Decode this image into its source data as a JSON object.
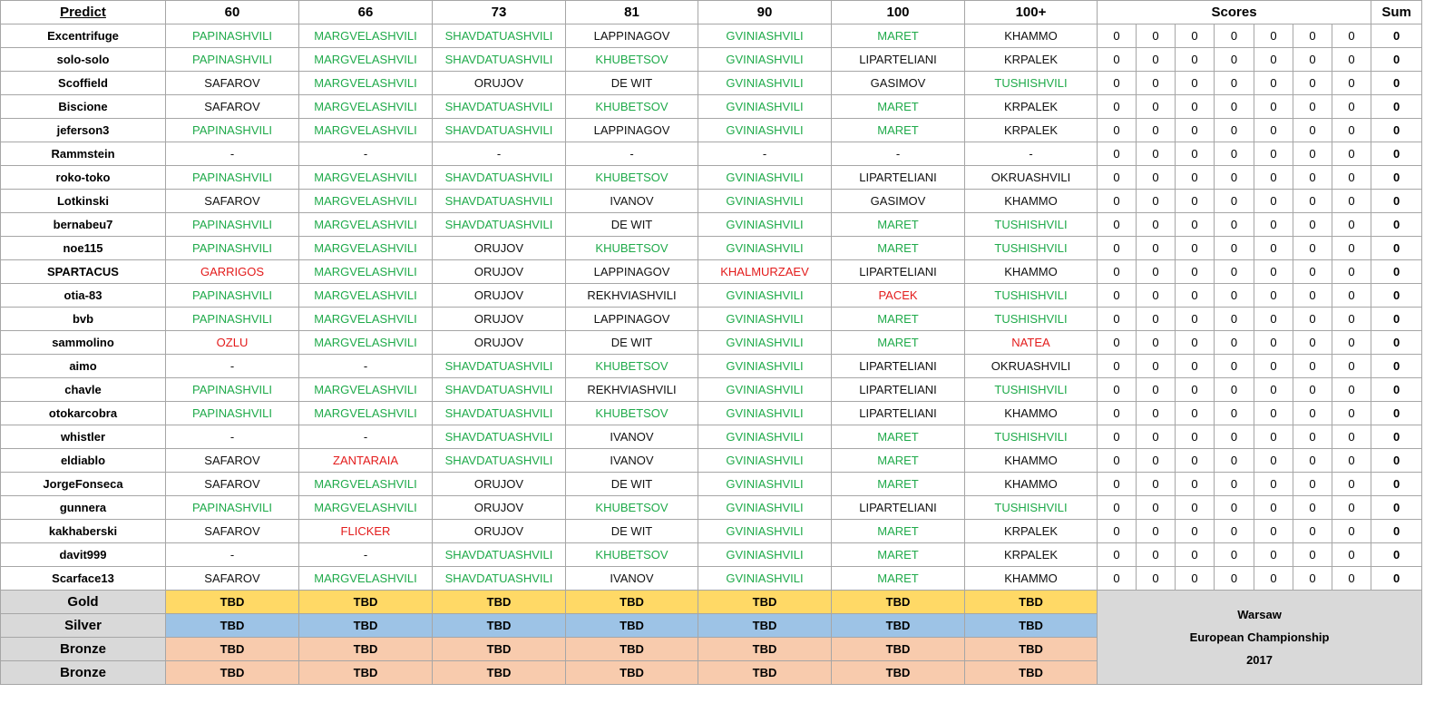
{
  "header": {
    "predict": "Predict",
    "categories": [
      "60",
      "66",
      "73",
      "81",
      "90",
      "100",
      "100+"
    ],
    "scores": "Scores",
    "sum": "Sum"
  },
  "colors": {
    "correct": "#1faa4a",
    "wrong": "#e31b1b",
    "neutral": "#111111",
    "gold": "#ffd966",
    "silver": "#9dc3e6",
    "bronze": "#f8cbad",
    "label_bg": "#d9d9d9"
  },
  "rows": [
    {
      "name": "Excentrifuge",
      "picks": [
        [
          "PAPINASHVILI",
          "g"
        ],
        [
          "MARGVELASHVILI",
          "g"
        ],
        [
          "SHAVDATUASHVILI",
          "g"
        ],
        [
          "LAPPINAGOV",
          "b"
        ],
        [
          "GVINIASHVILI",
          "g"
        ],
        [
          "MARET",
          "g"
        ],
        [
          "KHAMMO",
          "b"
        ]
      ],
      "scores": [
        "0",
        "0",
        "0",
        "0",
        "0",
        "0",
        "0"
      ],
      "sum": "0"
    },
    {
      "name": "solo-solo",
      "picks": [
        [
          "PAPINASHVILI",
          "g"
        ],
        [
          "MARGVELASHVILI",
          "g"
        ],
        [
          "SHAVDATUASHVILI",
          "g"
        ],
        [
          "KHUBETSOV",
          "g"
        ],
        [
          "GVINIASHVILI",
          "g"
        ],
        [
          "LIPARTELIANI",
          "b"
        ],
        [
          "KRPALEK",
          "b"
        ]
      ],
      "scores": [
        "0",
        "0",
        "0",
        "0",
        "0",
        "0",
        "0"
      ],
      "sum": "0"
    },
    {
      "name": "Scoffield",
      "picks": [
        [
          "SAFAROV",
          "b"
        ],
        [
          "MARGVELASHVILI",
          "g"
        ],
        [
          "ORUJOV",
          "b"
        ],
        [
          "DE WIT",
          "b"
        ],
        [
          "GVINIASHVILI",
          "g"
        ],
        [
          "GASIMOV",
          "b"
        ],
        [
          "TUSHISHVILI",
          "g"
        ]
      ],
      "scores": [
        "0",
        "0",
        "0",
        "0",
        "0",
        "0",
        "0"
      ],
      "sum": "0"
    },
    {
      "name": "Biscione",
      "picks": [
        [
          "SAFAROV",
          "b"
        ],
        [
          "MARGVELASHVILI",
          "g"
        ],
        [
          "SHAVDATUASHVILI",
          "g"
        ],
        [
          "KHUBETSOV",
          "g"
        ],
        [
          "GVINIASHVILI",
          "g"
        ],
        [
          "MARET",
          "g"
        ],
        [
          "KRPALEK",
          "b"
        ]
      ],
      "scores": [
        "0",
        "0",
        "0",
        "0",
        "0",
        "0",
        "0"
      ],
      "sum": "0"
    },
    {
      "name": "jeferson3",
      "picks": [
        [
          "PAPINASHVILI",
          "g"
        ],
        [
          "MARGVELASHVILI",
          "g"
        ],
        [
          "SHAVDATUASHVILI",
          "g"
        ],
        [
          "LAPPINAGOV",
          "b"
        ],
        [
          "GVINIASHVILI",
          "g"
        ],
        [
          "MARET",
          "g"
        ],
        [
          "KRPALEK",
          "b"
        ]
      ],
      "scores": [
        "0",
        "0",
        "0",
        "0",
        "0",
        "0",
        "0"
      ],
      "sum": "0"
    },
    {
      "name": "Rammstein",
      "picks": [
        [
          "-",
          "b"
        ],
        [
          "-",
          "b"
        ],
        [
          "-",
          "b"
        ],
        [
          "-",
          "b"
        ],
        [
          "-",
          "b"
        ],
        [
          "-",
          "b"
        ],
        [
          "-",
          "b"
        ]
      ],
      "scores": [
        "0",
        "0",
        "0",
        "0",
        "0",
        "0",
        "0"
      ],
      "sum": "0"
    },
    {
      "name": "roko-toko",
      "picks": [
        [
          "PAPINASHVILI",
          "g"
        ],
        [
          "MARGVELASHVILI",
          "g"
        ],
        [
          "SHAVDATUASHVILI",
          "g"
        ],
        [
          "KHUBETSOV",
          "g"
        ],
        [
          "GVINIASHVILI",
          "g"
        ],
        [
          "LIPARTELIANI",
          "b"
        ],
        [
          "OKRUASHVILI",
          "b"
        ]
      ],
      "scores": [
        "0",
        "0",
        "0",
        "0",
        "0",
        "0",
        "0"
      ],
      "sum": "0"
    },
    {
      "name": "Lotkinski",
      "picks": [
        [
          "SAFAROV",
          "b"
        ],
        [
          "MARGVELASHVILI",
          "g"
        ],
        [
          "SHAVDATUASHVILI",
          "g"
        ],
        [
          "IVANOV",
          "b"
        ],
        [
          "GVINIASHVILI",
          "g"
        ],
        [
          "GASIMOV",
          "b"
        ],
        [
          "KHAMMO",
          "b"
        ]
      ],
      "scores": [
        "0",
        "0",
        "0",
        "0",
        "0",
        "0",
        "0"
      ],
      "sum": "0"
    },
    {
      "name": "bernabeu7",
      "picks": [
        [
          "PAPINASHVILI",
          "g"
        ],
        [
          "MARGVELASHVILI",
          "g"
        ],
        [
          "SHAVDATUASHVILI",
          "g"
        ],
        [
          "DE WIT",
          "b"
        ],
        [
          "GVINIASHVILI",
          "g"
        ],
        [
          "MARET",
          "g"
        ],
        [
          "TUSHISHVILI",
          "g"
        ]
      ],
      "scores": [
        "0",
        "0",
        "0",
        "0",
        "0",
        "0",
        "0"
      ],
      "sum": "0"
    },
    {
      "name": "noe115",
      "picks": [
        [
          "PAPINASHVILI",
          "g"
        ],
        [
          "MARGVELASHVILI",
          "g"
        ],
        [
          "ORUJOV",
          "b"
        ],
        [
          "KHUBETSOV",
          "g"
        ],
        [
          "GVINIASHVILI",
          "g"
        ],
        [
          "MARET",
          "g"
        ],
        [
          "TUSHISHVILI",
          "g"
        ]
      ],
      "scores": [
        "0",
        "0",
        "0",
        "0",
        "0",
        "0",
        "0"
      ],
      "sum": "0"
    },
    {
      "name": "SPARTACUS",
      "picks": [
        [
          "GARRIGOS",
          "r"
        ],
        [
          "MARGVELASHVILI",
          "g"
        ],
        [
          "ORUJOV",
          "b"
        ],
        [
          "LAPPINAGOV",
          "b"
        ],
        [
          "KHALMURZAEV",
          "r"
        ],
        [
          "LIPARTELIANI",
          "b"
        ],
        [
          "KHAMMO",
          "b"
        ]
      ],
      "scores": [
        "0",
        "0",
        "0",
        "0",
        "0",
        "0",
        "0"
      ],
      "sum": "0"
    },
    {
      "name": "otia-83",
      "picks": [
        [
          "PAPINASHVILI",
          "g"
        ],
        [
          "MARGVELASHVILI",
          "g"
        ],
        [
          "ORUJOV",
          "b"
        ],
        [
          "REKHVIASHVILI",
          "b"
        ],
        [
          "GVINIASHVILI",
          "g"
        ],
        [
          "PACEK",
          "r"
        ],
        [
          "TUSHISHVILI",
          "g"
        ]
      ],
      "scores": [
        "0",
        "0",
        "0",
        "0",
        "0",
        "0",
        "0"
      ],
      "sum": "0"
    },
    {
      "name": "bvb",
      "picks": [
        [
          "PAPINASHVILI",
          "g"
        ],
        [
          "MARGVELASHVILI",
          "g"
        ],
        [
          "ORUJOV",
          "b"
        ],
        [
          "LAPPINAGOV",
          "b"
        ],
        [
          "GVINIASHVILI",
          "g"
        ],
        [
          "MARET",
          "g"
        ],
        [
          "TUSHISHVILI",
          "g"
        ]
      ],
      "scores": [
        "0",
        "0",
        "0",
        "0",
        "0",
        "0",
        "0"
      ],
      "sum": "0"
    },
    {
      "name": "sammolino",
      "picks": [
        [
          "OZLU",
          "r"
        ],
        [
          "MARGVELASHVILI",
          "g"
        ],
        [
          "ORUJOV",
          "b"
        ],
        [
          "DE WIT",
          "b"
        ],
        [
          "GVINIASHVILI",
          "g"
        ],
        [
          "MARET",
          "g"
        ],
        [
          "NATEA",
          "r"
        ]
      ],
      "scores": [
        "0",
        "0",
        "0",
        "0",
        "0",
        "0",
        "0"
      ],
      "sum": "0"
    },
    {
      "name": "aimo",
      "picks": [
        [
          "-",
          "b"
        ],
        [
          "-",
          "b"
        ],
        [
          "SHAVDATUASHVILI",
          "g"
        ],
        [
          "KHUBETSOV",
          "g"
        ],
        [
          "GVINIASHVILI",
          "g"
        ],
        [
          "LIPARTELIANI",
          "b"
        ],
        [
          "OKRUASHVILI",
          "b"
        ]
      ],
      "scores": [
        "0",
        "0",
        "0",
        "0",
        "0",
        "0",
        "0"
      ],
      "sum": "0"
    },
    {
      "name": "chavle",
      "picks": [
        [
          "PAPINASHVILI",
          "g"
        ],
        [
          "MARGVELASHVILI",
          "g"
        ],
        [
          "SHAVDATUASHVILI",
          "g"
        ],
        [
          "REKHVIASHVILI",
          "b"
        ],
        [
          "GVINIASHVILI",
          "g"
        ],
        [
          "LIPARTELIANI",
          "b"
        ],
        [
          "TUSHISHVILI",
          "g"
        ]
      ],
      "scores": [
        "0",
        "0",
        "0",
        "0",
        "0",
        "0",
        "0"
      ],
      "sum": "0"
    },
    {
      "name": "otokarcobra",
      "picks": [
        [
          "PAPINASHVILI",
          "g"
        ],
        [
          "MARGVELASHVILI",
          "g"
        ],
        [
          "SHAVDATUASHVILI",
          "g"
        ],
        [
          "KHUBETSOV",
          "g"
        ],
        [
          "GVINIASHVILI",
          "g"
        ],
        [
          "LIPARTELIANI",
          "b"
        ],
        [
          "KHAMMO",
          "b"
        ]
      ],
      "scores": [
        "0",
        "0",
        "0",
        "0",
        "0",
        "0",
        "0"
      ],
      "sum": "0"
    },
    {
      "name": "whistler",
      "picks": [
        [
          "-",
          "b"
        ],
        [
          "-",
          "b"
        ],
        [
          "SHAVDATUASHVILI",
          "g"
        ],
        [
          "IVANOV",
          "b"
        ],
        [
          "GVINIASHVILI",
          "g"
        ],
        [
          "MARET",
          "g"
        ],
        [
          "TUSHISHVILI",
          "g"
        ]
      ],
      "scores": [
        "0",
        "0",
        "0",
        "0",
        "0",
        "0",
        "0"
      ],
      "sum": "0"
    },
    {
      "name": "eldiablo",
      "picks": [
        [
          "SAFAROV",
          "b"
        ],
        [
          "ZANTARAIA",
          "r"
        ],
        [
          "SHAVDATUASHVILI",
          "g"
        ],
        [
          "IVANOV",
          "b"
        ],
        [
          "GVINIASHVILI",
          "g"
        ],
        [
          "MARET",
          "g"
        ],
        [
          "KHAMMO",
          "b"
        ]
      ],
      "scores": [
        "0",
        "0",
        "0",
        "0",
        "0",
        "0",
        "0"
      ],
      "sum": "0"
    },
    {
      "name": "JorgeFonseca",
      "picks": [
        [
          "SAFAROV",
          "b"
        ],
        [
          "MARGVELASHVILI",
          "g"
        ],
        [
          "ORUJOV",
          "b"
        ],
        [
          "DE WIT",
          "b"
        ],
        [
          "GVINIASHVILI",
          "g"
        ],
        [
          "MARET",
          "g"
        ],
        [
          "KHAMMO",
          "b"
        ]
      ],
      "scores": [
        "0",
        "0",
        "0",
        "0",
        "0",
        "0",
        "0"
      ],
      "sum": "0"
    },
    {
      "name": "gunnera",
      "picks": [
        [
          "PAPINASHVILI",
          "g"
        ],
        [
          "MARGVELASHVILI",
          "g"
        ],
        [
          "ORUJOV",
          "b"
        ],
        [
          "KHUBETSOV",
          "g"
        ],
        [
          "GVINIASHVILI",
          "g"
        ],
        [
          "LIPARTELIANI",
          "b"
        ],
        [
          "TUSHISHVILI",
          "g"
        ]
      ],
      "scores": [
        "0",
        "0",
        "0",
        "0",
        "0",
        "0",
        "0"
      ],
      "sum": "0"
    },
    {
      "name": "kakhaberski",
      "picks": [
        [
          "SAFAROV",
          "b"
        ],
        [
          "FLICKER",
          "r"
        ],
        [
          "ORUJOV",
          "b"
        ],
        [
          "DE WIT",
          "b"
        ],
        [
          "GVINIASHVILI",
          "g"
        ],
        [
          "MARET",
          "g"
        ],
        [
          "KRPALEK",
          "b"
        ]
      ],
      "scores": [
        "0",
        "0",
        "0",
        "0",
        "0",
        "0",
        "0"
      ],
      "sum": "0"
    },
    {
      "name": "davit999",
      "picks": [
        [
          "-",
          "b"
        ],
        [
          "-",
          "b"
        ],
        [
          "SHAVDATUASHVILI",
          "g"
        ],
        [
          "KHUBETSOV",
          "g"
        ],
        [
          "GVINIASHVILI",
          "g"
        ],
        [
          "MARET",
          "g"
        ],
        [
          "KRPALEK",
          "b"
        ]
      ],
      "scores": [
        "0",
        "0",
        "0",
        "0",
        "0",
        "0",
        "0"
      ],
      "sum": "0"
    },
    {
      "name": "Scarface13",
      "picks": [
        [
          "SAFAROV",
          "b"
        ],
        [
          "MARGVELASHVILI",
          "g"
        ],
        [
          "SHAVDATUASHVILI",
          "g"
        ],
        [
          "IVANOV",
          "b"
        ],
        [
          "GVINIASHVILI",
          "g"
        ],
        [
          "MARET",
          "g"
        ],
        [
          "KHAMMO",
          "b"
        ]
      ],
      "scores": [
        "0",
        "0",
        "0",
        "0",
        "0",
        "0",
        "0"
      ],
      "sum": "0"
    }
  ],
  "medals": [
    {
      "label": "Gold",
      "kind": "gold",
      "values": [
        "TBD",
        "TBD",
        "TBD",
        "TBD",
        "TBD",
        "TBD",
        "TBD"
      ]
    },
    {
      "label": "Silver",
      "kind": "silver",
      "values": [
        "TBD",
        "TBD",
        "TBD",
        "TBD",
        "TBD",
        "TBD",
        "TBD"
      ]
    },
    {
      "label": "Bronze",
      "kind": "bronze",
      "values": [
        "TBD",
        "TBD",
        "TBD",
        "TBD",
        "TBD",
        "TBD",
        "TBD"
      ]
    },
    {
      "label": "Bronze",
      "kind": "bronze",
      "values": [
        "TBD",
        "TBD",
        "TBD",
        "TBD",
        "TBD",
        "TBD",
        "TBD"
      ]
    }
  ],
  "caption": {
    "line1": "Warsaw",
    "line2": "European Championship",
    "line3": "2017"
  }
}
